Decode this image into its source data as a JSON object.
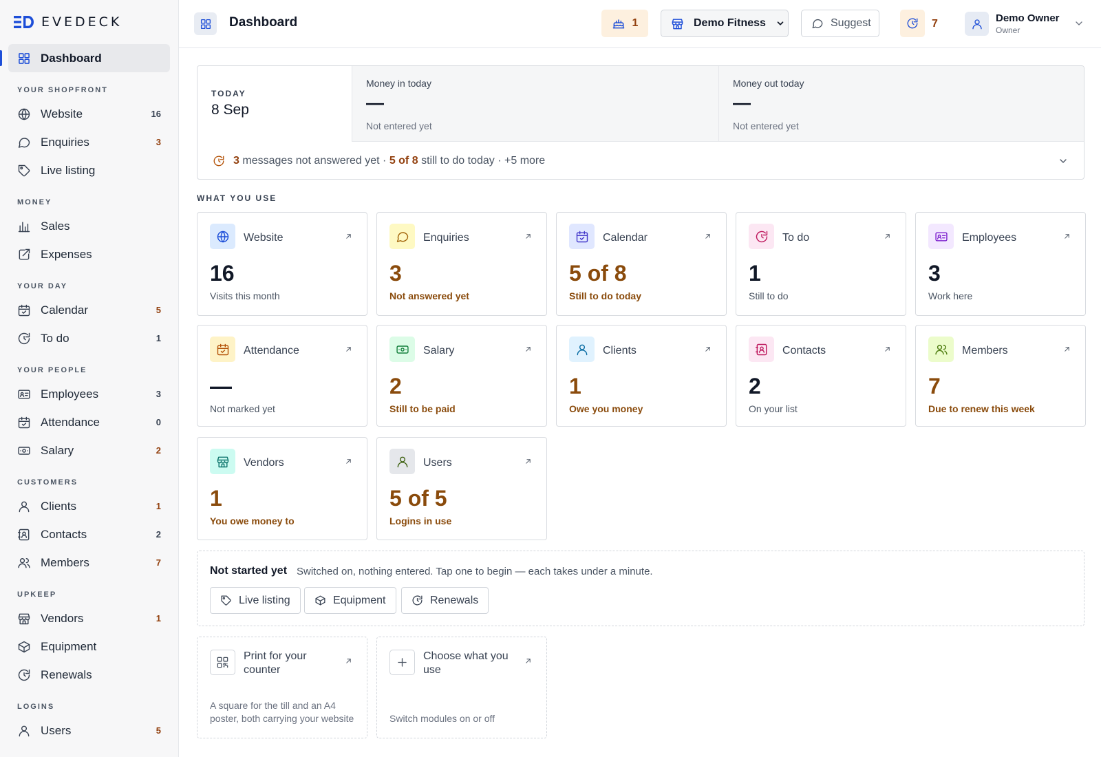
{
  "brand": {
    "name": "EVEDECK"
  },
  "sidebar": {
    "active": {
      "label": "Dashboard",
      "icon": "grid-icon"
    },
    "sections": [
      {
        "title": "YOUR SHOPFRONT",
        "items": [
          {
            "label": "Website",
            "count": "16",
            "icon": "globe-icon"
          },
          {
            "label": "Enquiries",
            "count": "3",
            "icon": "chat-icon",
            "amber": true
          },
          {
            "label": "Live listing",
            "count": "",
            "icon": "tag-icon"
          }
        ]
      },
      {
        "title": "MONEY",
        "items": [
          {
            "label": "Sales",
            "count": "",
            "icon": "bar-chart-icon"
          },
          {
            "label": "Expenses",
            "count": "",
            "icon": "external-link-icon"
          }
        ]
      },
      {
        "title": "YOUR DAY",
        "items": [
          {
            "label": "Calendar",
            "count": "5",
            "icon": "calendar-check-icon",
            "amber": true
          },
          {
            "label": "To do",
            "count": "1",
            "icon": "refresh-icon"
          }
        ]
      },
      {
        "title": "YOUR PEOPLE",
        "items": [
          {
            "label": "Employees",
            "count": "3",
            "icon": "id-card-icon"
          },
          {
            "label": "Attendance",
            "count": "0",
            "icon": "calendar-check-icon"
          },
          {
            "label": "Salary",
            "count": "2",
            "icon": "banknote-icon",
            "amber": true
          }
        ]
      },
      {
        "title": "CUSTOMERS",
        "items": [
          {
            "label": "Clients",
            "count": "1",
            "icon": "user-icon",
            "amber": true
          },
          {
            "label": "Contacts",
            "count": "2",
            "icon": "contact-book-icon"
          },
          {
            "label": "Members",
            "count": "7",
            "icon": "users-icon",
            "amber": true
          }
        ]
      },
      {
        "title": "UPKEEP",
        "items": [
          {
            "label": "Vendors",
            "count": "1",
            "icon": "store-icon",
            "amber": true
          },
          {
            "label": "Equipment",
            "count": "",
            "icon": "box-icon"
          },
          {
            "label": "Renewals",
            "count": "",
            "icon": "refresh-icon"
          }
        ]
      },
      {
        "title": "LOGINS",
        "items": [
          {
            "label": "Users",
            "count": "5",
            "icon": "user-icon",
            "amber": true
          }
        ]
      }
    ]
  },
  "header": {
    "title": "Dashboard",
    "alert_count": "1",
    "business": "Demo Fitness",
    "suggest_label": "Suggest",
    "todo_count": "7",
    "user_name": "Demo Owner",
    "user_role": "Owner"
  },
  "today": {
    "label": "TODAY",
    "date": "8 Sep",
    "money_in_label": "Money in today",
    "money_in_value": "—",
    "money_in_sub": "Not entered yet",
    "money_out_label": "Money out today",
    "money_out_value": "—",
    "money_out_sub": "Not entered yet",
    "summary": {
      "msg_count": "3",
      "msg_text": "messages not answered yet ·",
      "todo_strong": "5 of 8",
      "todo_text": "still to do today · +5 more"
    }
  },
  "what_you_use": {
    "title": "WHAT YOU USE",
    "tiles": [
      {
        "title": "Website",
        "value": "16",
        "sub": "Visits this month",
        "icon": "globe-icon",
        "bg": "#dbeafe",
        "fg": "#1d4ed8",
        "warn": false
      },
      {
        "title": "Enquiries",
        "value": "3",
        "sub": "Not answered yet",
        "icon": "chat-icon",
        "bg": "#fef9c3",
        "fg": "#a16207",
        "warn": true
      },
      {
        "title": "Calendar",
        "value": "5 of 8",
        "sub": "Still to do today",
        "icon": "calendar-check-icon",
        "bg": "#e0e7ff",
        "fg": "#4338ca",
        "warn": true
      },
      {
        "title": "To do",
        "value": "1",
        "sub": "Still to do",
        "icon": "refresh-icon",
        "bg": "#fce7f3",
        "fg": "#be185d",
        "warn": false
      },
      {
        "title": "Employees",
        "value": "3",
        "sub": "Work here",
        "icon": "id-card-icon",
        "bg": "#f3e8ff",
        "fg": "#7e22ce",
        "warn": false
      },
      {
        "title": "Attendance",
        "value": "—",
        "sub": "Not marked yet",
        "icon": "calendar-check-icon",
        "bg": "#fef3c7",
        "fg": "#b45309",
        "warn": false
      },
      {
        "title": "Salary",
        "value": "2",
        "sub": "Still to be paid",
        "icon": "banknote-icon",
        "bg": "#dcfce7",
        "fg": "#15803d",
        "warn": true
      },
      {
        "title": "Clients",
        "value": "1",
        "sub": "Owe you money",
        "icon": "user-icon",
        "bg": "#e0f2fe",
        "fg": "#0369a1",
        "warn": true
      },
      {
        "title": "Contacts",
        "value": "2",
        "sub": "On your list",
        "icon": "contact-book-icon",
        "bg": "#fce7f3",
        "fg": "#be185d",
        "warn": false
      },
      {
        "title": "Members",
        "value": "7",
        "sub": "Due to renew this week",
        "icon": "users-icon",
        "bg": "#ecfccb",
        "fg": "#4d7c0f",
        "warn": true
      },
      {
        "title": "Vendors",
        "value": "1",
        "sub": "You owe money to",
        "icon": "store-icon",
        "bg": "#ccfbf1",
        "fg": "#0f766e",
        "warn": true
      },
      {
        "title": "Users",
        "value": "5 of 5",
        "sub": "Logins in use",
        "icon": "user-icon",
        "bg": "#e5e7eb",
        "fg": "#3f6212",
        "warn": true
      }
    ]
  },
  "not_started": {
    "title": "Not started yet",
    "desc": "Switched on, nothing entered. Tap one to begin — each takes under a minute.",
    "buttons": [
      {
        "label": "Live listing",
        "icon": "tag-icon"
      },
      {
        "label": "Equipment",
        "icon": "box-icon"
      },
      {
        "label": "Renewals",
        "icon": "refresh-icon"
      }
    ]
  },
  "bottom_cards": [
    {
      "title": "Print for your counter",
      "sub": "A square for the till and an A4 poster, both carrying your website",
      "icon": "qr-code-icon"
    },
    {
      "title": "Choose what you use",
      "sub": "Switch modules on or off",
      "icon": "plus-icon"
    }
  ]
}
